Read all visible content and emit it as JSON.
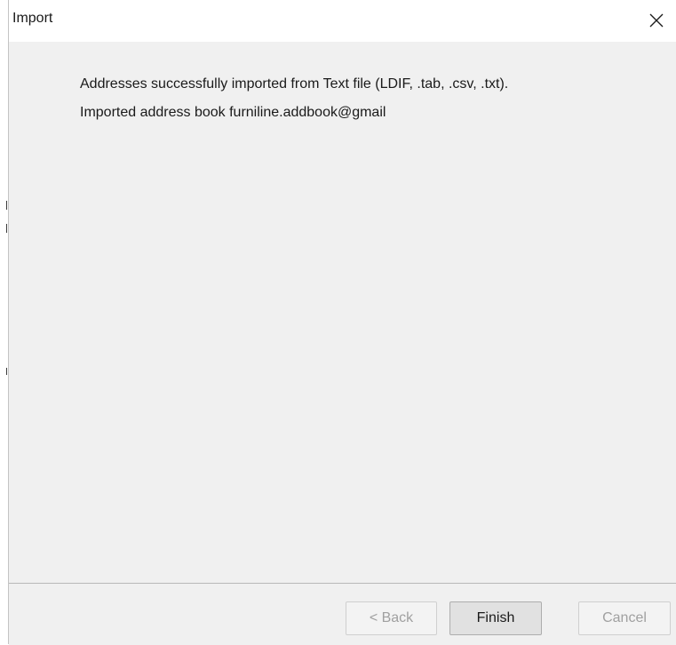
{
  "dialog": {
    "title": "Import",
    "close_icon": "close-icon"
  },
  "content": {
    "messages": [
      "Addresses successfully imported from Text file (LDIF, .tab, .csv, .txt).",
      "Imported address book furniline.addbook@gmail"
    ]
  },
  "footer": {
    "back_label": "< Back",
    "finish_label": "Finish",
    "cancel_label": "Cancel",
    "back_enabled": false,
    "finish_enabled": true,
    "cancel_enabled": false
  },
  "colors": {
    "dialog_bg": "#f0f0f0",
    "titlebar_bg": "#ffffff",
    "disabled_text": "#a0a0a0"
  }
}
